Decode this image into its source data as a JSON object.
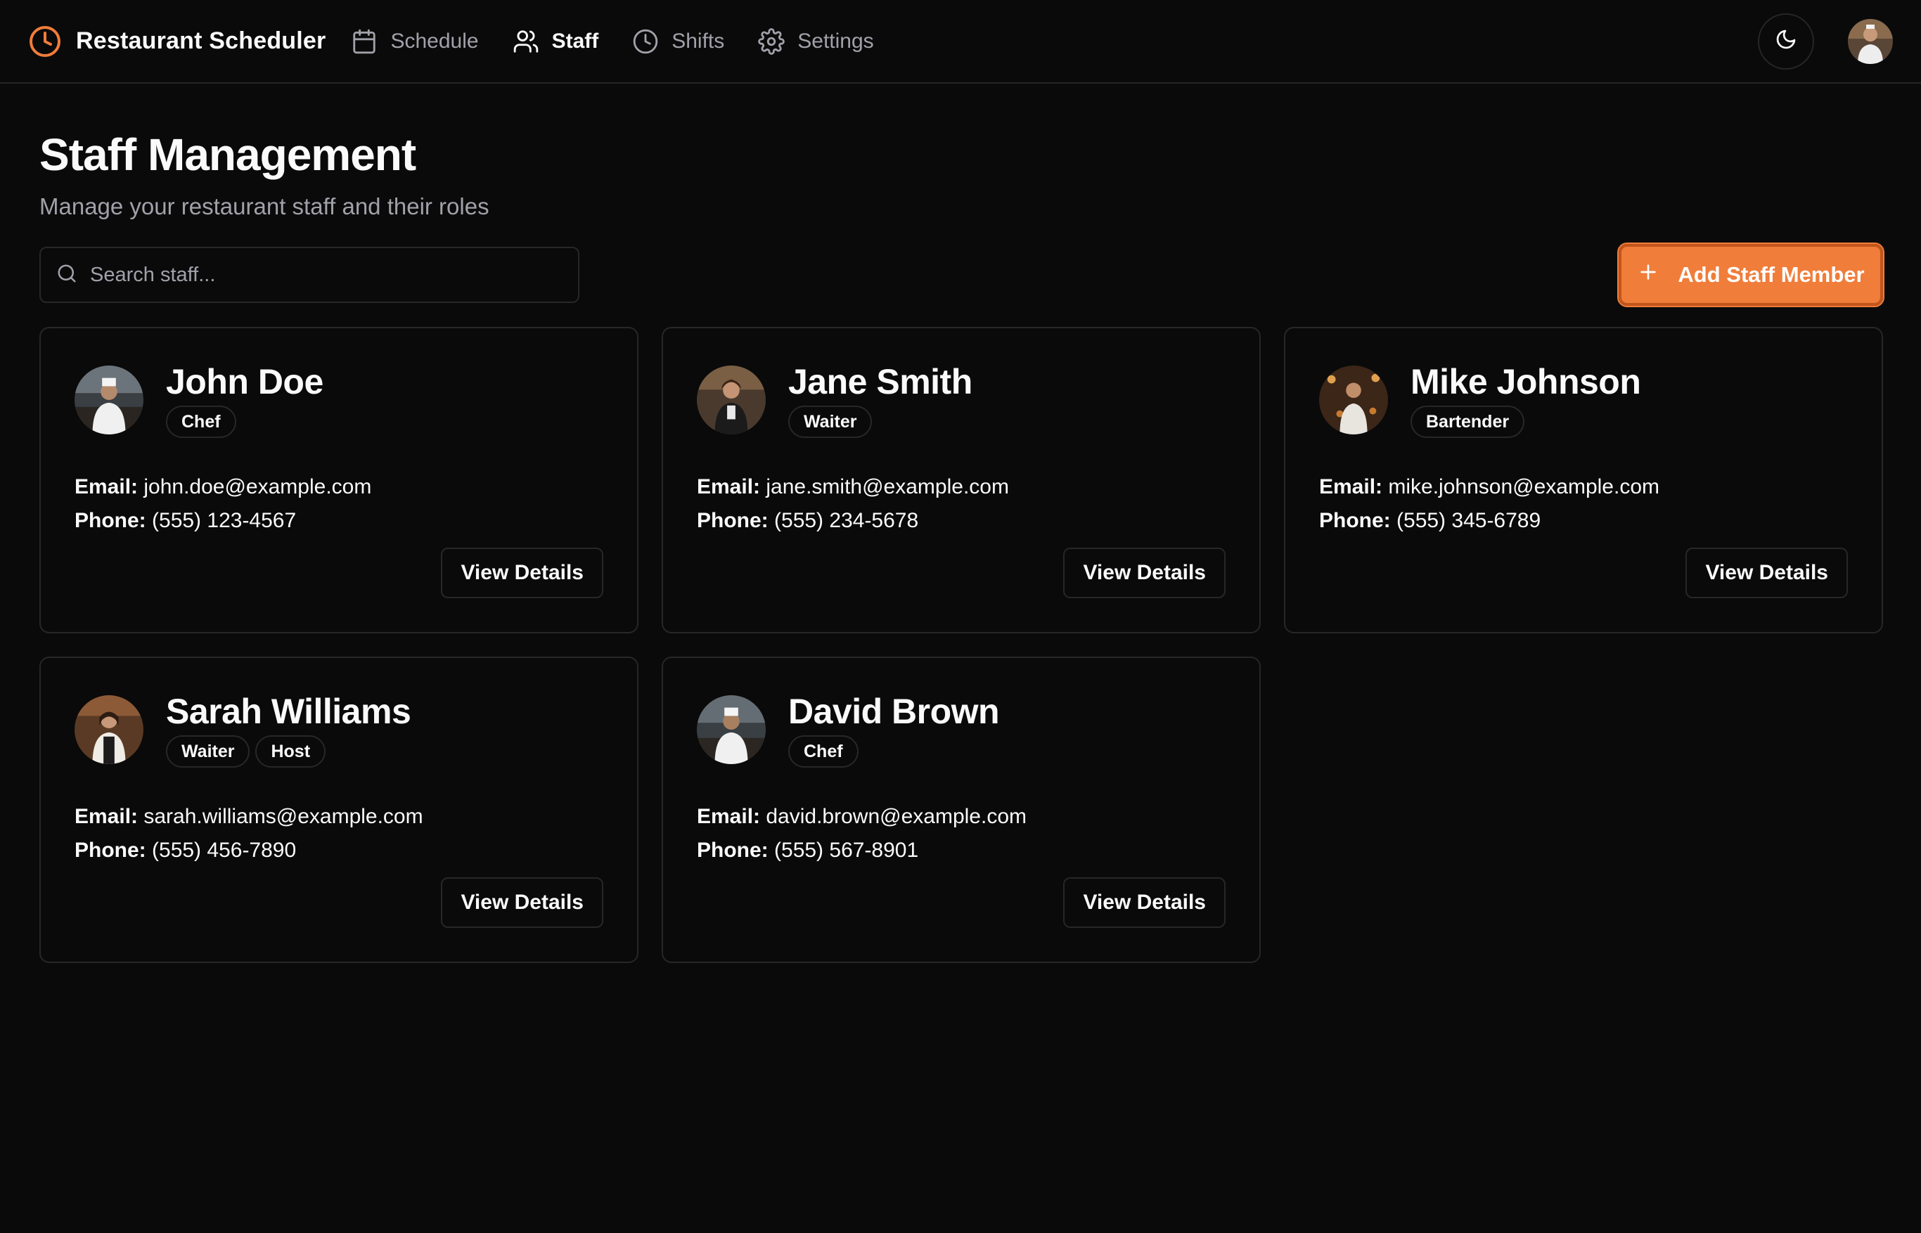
{
  "app": {
    "title": "Restaurant Scheduler",
    "accent_color": "#f07d3a"
  },
  "nav": {
    "items": [
      {
        "label": "Schedule",
        "icon": "calendar-icon",
        "active": false
      },
      {
        "label": "Staff",
        "icon": "users-icon",
        "active": true
      },
      {
        "label": "Shifts",
        "icon": "clock-icon",
        "active": false
      },
      {
        "label": "Settings",
        "icon": "gear-icon",
        "active": false
      }
    ]
  },
  "header": {
    "theme_toggle_icon": "moon-icon",
    "user_avatar_icon": "user-avatar-photo"
  },
  "page": {
    "title": "Staff Management",
    "subtitle": "Manage your restaurant staff and their roles"
  },
  "search": {
    "placeholder": "Search staff...",
    "value": ""
  },
  "actions": {
    "add_label": "Add Staff Member"
  },
  "labels": {
    "email": "Email:",
    "phone": "Phone:",
    "view_details": "View Details"
  },
  "staff": [
    {
      "name": "John Doe",
      "roles": [
        "Chef"
      ],
      "email": "john.doe@example.com",
      "phone": "(555) 123-4567"
    },
    {
      "name": "Jane Smith",
      "roles": [
        "Waiter"
      ],
      "email": "jane.smith@example.com",
      "phone": "(555) 234-5678"
    },
    {
      "name": "Mike Johnson",
      "roles": [
        "Bartender"
      ],
      "email": "mike.johnson@example.com",
      "phone": "(555) 345-6789"
    },
    {
      "name": "Sarah Williams",
      "roles": [
        "Waiter",
        "Host"
      ],
      "email": "sarah.williams@example.com",
      "phone": "(555) 456-7890"
    },
    {
      "name": "David Brown",
      "roles": [
        "Chef"
      ],
      "email": "david.brown@example.com",
      "phone": "(555) 567-8901"
    }
  ]
}
